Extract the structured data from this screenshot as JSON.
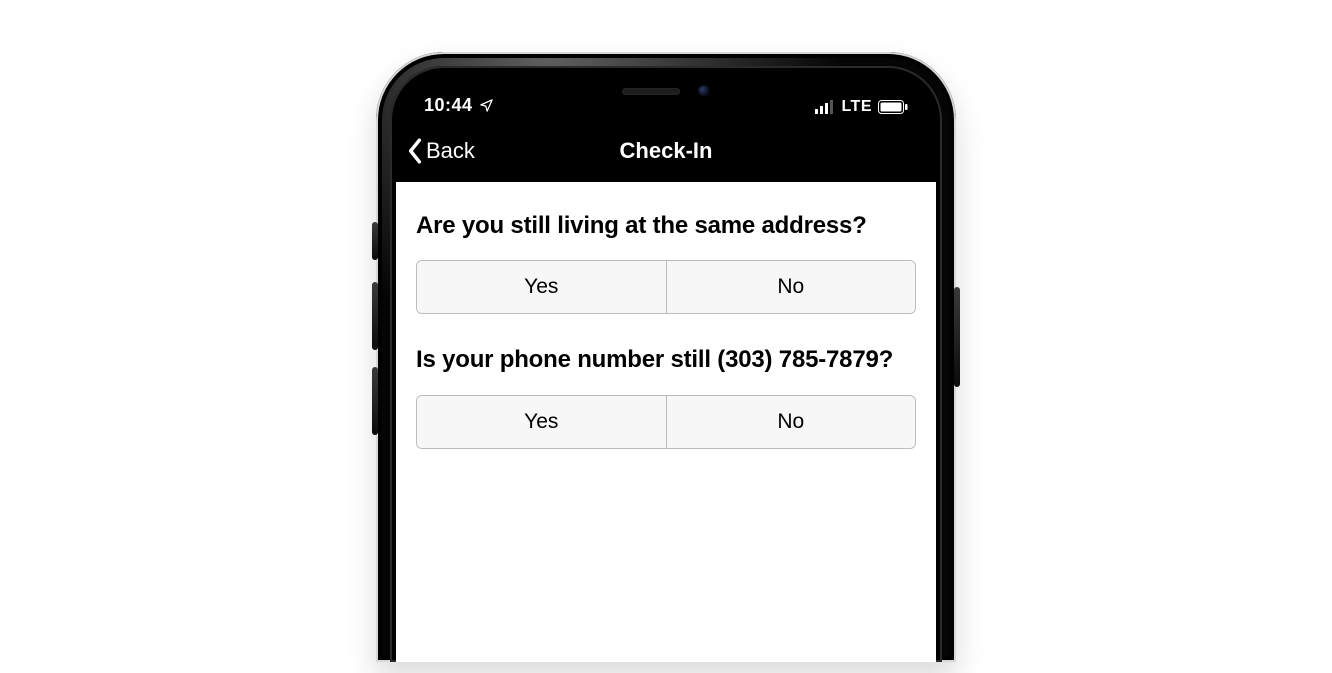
{
  "status": {
    "time": "10:44",
    "network_label": "LTE"
  },
  "nav": {
    "back_label": "Back",
    "title": "Check-In"
  },
  "questions": [
    {
      "prompt": "Are you still living at the same address?",
      "yes": "Yes",
      "no": "No"
    },
    {
      "prompt": "Is your phone number still (303) 785-7879?",
      "yes": "Yes",
      "no": "No"
    }
  ]
}
